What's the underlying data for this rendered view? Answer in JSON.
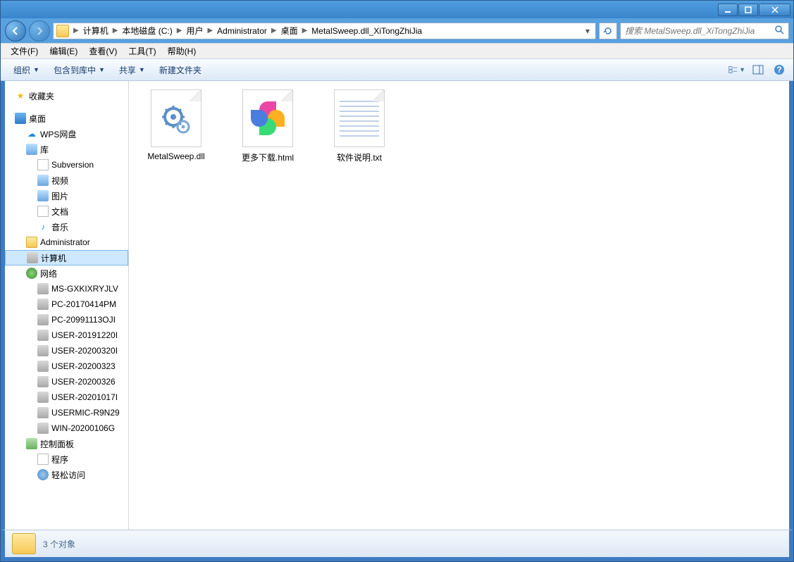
{
  "titlebar": {},
  "breadcrumb": {
    "items": [
      "计算机",
      "本地磁盘 (C:)",
      "用户",
      "Administrator",
      "桌面",
      "MetalSweep.dll_XiTongZhiJia"
    ]
  },
  "search": {
    "placeholder": "搜索 MetalSweep.dll_XiTongZhiJia"
  },
  "menu": {
    "file": "文件(F)",
    "edit": "编辑(E)",
    "view": "查看(V)",
    "tools": "工具(T)",
    "help": "帮助(H)"
  },
  "toolbar": {
    "organize": "组织",
    "include": "包含到库中",
    "share": "共享",
    "newfolder": "新建文件夹"
  },
  "nav": {
    "favorites": "收藏夹",
    "desktop": "桌面",
    "wps": "WPS网盘",
    "libraries": "库",
    "subversion": "Subversion",
    "videos": "视频",
    "pictures": "图片",
    "documents": "文档",
    "music": "音乐",
    "admin": "Administrator",
    "computer": "计算机",
    "network": "网络",
    "net_items": [
      "MS-GXKIXRYJLV",
      "PC-20170414PM",
      "PC-20991113OJI",
      "USER-20191220I",
      "USER-20200320I",
      "USER-20200323",
      "USER-20200326",
      "USER-20201017I",
      "USERMIC-R9N29",
      "WIN-20200106G"
    ],
    "controlpanel": "控制面板",
    "programs": "程序",
    "ease": "轻松访问"
  },
  "files": [
    {
      "name": "MetalSweep.dll",
      "type": "dll"
    },
    {
      "name": "更多下载.html",
      "type": "html"
    },
    {
      "name": "软件说明.txt",
      "type": "txt"
    }
  ],
  "status": {
    "text": "3 个对象"
  }
}
